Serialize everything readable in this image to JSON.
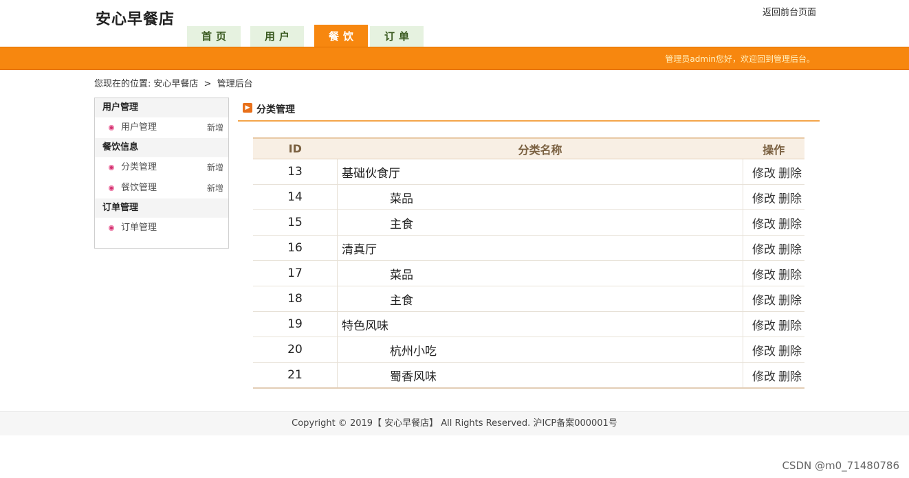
{
  "site": {
    "title": "安心早餐店",
    "back_link": "返回前台页面"
  },
  "nav": {
    "tabs": [
      {
        "label": "首页",
        "active": false
      },
      {
        "label": "用户",
        "active": false
      },
      {
        "label": "餐饮",
        "active": true
      },
      {
        "label": "订单",
        "active": false
      }
    ]
  },
  "topbar": {
    "welcome": "管理员admin您好，欢迎回到管理后台。",
    "color": "#f7870f"
  },
  "breadcrumb": {
    "prefix": "您现在的位置:",
    "home": "安心早餐店",
    "sep": ">",
    "current": "管理后台"
  },
  "sidebar": {
    "groups": [
      {
        "title": "用户管理",
        "items": [
          {
            "label": "用户管理",
            "action": "新增"
          }
        ]
      },
      {
        "title": "餐饮信息",
        "items": [
          {
            "label": "分类管理",
            "action": "新增"
          },
          {
            "label": "餐饮管理",
            "action": "新增"
          }
        ]
      },
      {
        "title": "订单管理",
        "items": [
          {
            "label": "订单管理",
            "action": ""
          }
        ]
      }
    ]
  },
  "section": {
    "title": "分类管理"
  },
  "table": {
    "headers": {
      "id": "ID",
      "name": "分类名称",
      "ops": "操作"
    },
    "edit_label": "修改",
    "delete_label": "删除",
    "rows": [
      {
        "id": "13",
        "name": "基础伙食厅",
        "child": false
      },
      {
        "id": "14",
        "name": "菜品",
        "child": true
      },
      {
        "id": "15",
        "name": "主食",
        "child": true
      },
      {
        "id": "16",
        "name": "清真厅",
        "child": false
      },
      {
        "id": "17",
        "name": "菜品",
        "child": true
      },
      {
        "id": "18",
        "name": "主食",
        "child": true
      },
      {
        "id": "19",
        "name": "特色风味",
        "child": false
      },
      {
        "id": "20",
        "name": "杭州小吃",
        "child": true
      },
      {
        "id": "21",
        "name": "蜀香风味",
        "child": true
      }
    ]
  },
  "footer": {
    "text": "Copyright © 2019【 安心早餐店】 All Rights Reserved. 沪ICP备案000001号"
  },
  "corner": {
    "text": "CSDN @m0_71480786"
  }
}
